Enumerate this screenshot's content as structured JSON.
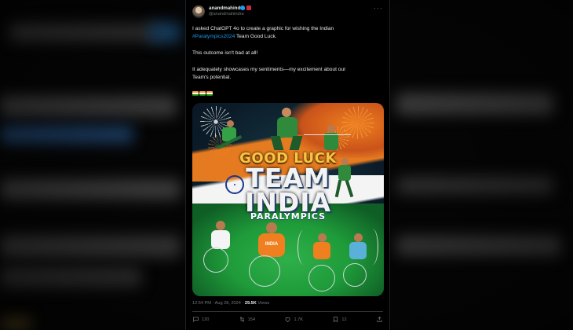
{
  "tweet": {
    "display_name": "anandmahindra",
    "handle": "@anandmahindra",
    "more_label": "···",
    "paragraph_1": "I asked  ChatGPT 4o to create a graphic for wishing the Indian",
    "hashtag": "#Paralympics2024",
    "paragraph_1_tail": " Team Good Luck.",
    "paragraph_2": "This outcome isn't bad at all!",
    "paragraph_3a": "It adequately showcases my sentiments—my excitement about our",
    "paragraph_3b": "Team's potential.",
    "flags_icon": "indian-flag-icon"
  },
  "poster": {
    "line_1": "GOOD LUCK",
    "line_2": "TEAM",
    "line_3": "INDIA",
    "line_4": "PARALYMPICS",
    "jersey_text": "INDIA",
    "colors": {
      "saffron": "#f07f1f",
      "white": "#f4f4f4",
      "green": "#1f9b3a",
      "navy": "#163a8a",
      "gold": "#f7c640"
    }
  },
  "meta": {
    "time": "12:54 PM · Aug 28, 2024 · ",
    "views_count": "29.5K",
    "views_label": " Views"
  },
  "actions": {
    "reply_count": "120",
    "retweet_count": "154",
    "like_count": "1.7K",
    "bookmark_count": "12"
  }
}
